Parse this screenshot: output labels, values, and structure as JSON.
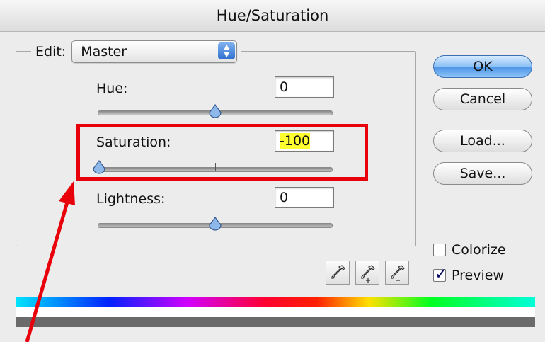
{
  "dialog": {
    "title": "Hue/Saturation"
  },
  "edit": {
    "label": "Edit:",
    "value": "Master",
    "arrows": "▲\n▼"
  },
  "hue": {
    "label": "Hue:",
    "value": "0",
    "slider_fraction": 0.5
  },
  "saturation": {
    "label": "Saturation:",
    "value": "-100",
    "slider_fraction": 0.0
  },
  "lightness": {
    "label": "Lightness:",
    "value": "0",
    "slider_fraction": 0.5
  },
  "buttons": {
    "ok": "OK",
    "cancel": "Cancel",
    "load": "Load...",
    "save": "Save..."
  },
  "options": {
    "colorize_label": "Colorize",
    "colorize_checked": false,
    "preview_label": "Preview",
    "preview_checked": true
  },
  "icons": [
    "eyedropper-icon",
    "eyedropper-plus-icon",
    "eyedropper-minus-icon"
  ],
  "colors": {
    "highlight": "#ffff30",
    "annotation": "#e8000b",
    "default_button": "#4a93e6"
  }
}
